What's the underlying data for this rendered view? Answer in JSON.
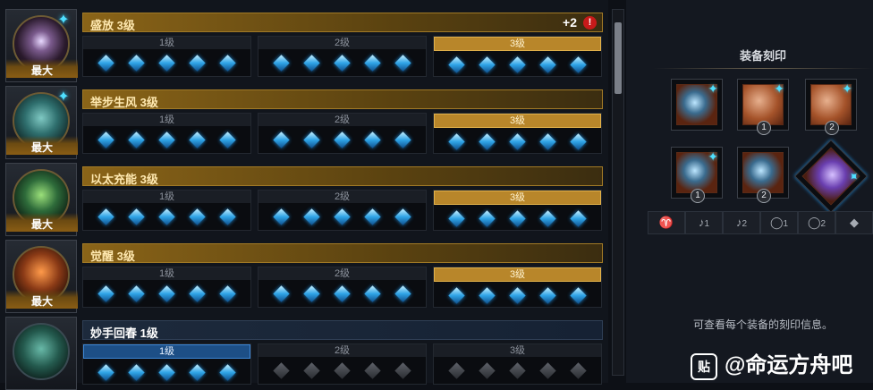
{
  "rows": [
    {
      "title": "盛放 3级",
      "badge": "最大",
      "plus": "+2",
      "warn": "!",
      "tiers": [
        "1级",
        "2级",
        "3级"
      ],
      "active_tier": 3
    },
    {
      "title": "举步生风 3级",
      "badge": "最大",
      "tiers": [
        "1级",
        "2级",
        "3级"
      ],
      "active_tier": 3
    },
    {
      "title": "以太充能 3级",
      "badge": "最大",
      "tiers": [
        "1级",
        "2级",
        "3级"
      ],
      "active_tier": 3
    },
    {
      "title": "觉醒 3级",
      "badge": "最大",
      "tiers": [
        "1级",
        "2级",
        "3级"
      ],
      "active_tier": 3
    },
    {
      "title": "妙手回春 1级",
      "badge": "",
      "tiers": [
        "1级",
        "2级",
        "3级"
      ],
      "active_tier": 1
    }
  ],
  "equipment_panel": {
    "title": "装备刻印",
    "slots": [
      {
        "icon": "necklace-icon",
        "num": ""
      },
      {
        "icon": "earring-icon",
        "num": "1"
      },
      {
        "icon": "earring-icon",
        "num": "2"
      },
      {
        "icon": "ring-icon",
        "num": "1"
      },
      {
        "icon": "ring-icon",
        "num": "2"
      },
      {
        "icon": "crystal-icon",
        "num": ""
      }
    ],
    "tab_nums": [
      "",
      "1",
      "2",
      "1",
      "2",
      ""
    ],
    "info": "可查看每个装备的刻印信息。"
  },
  "watermark": {
    "icon": "贴",
    "text": "@命运方舟吧"
  },
  "colors": {
    "gold": "#b8862a",
    "blue": "#1d4f86",
    "gem": "#2ea3e6",
    "rune": "#4fe0ff"
  }
}
